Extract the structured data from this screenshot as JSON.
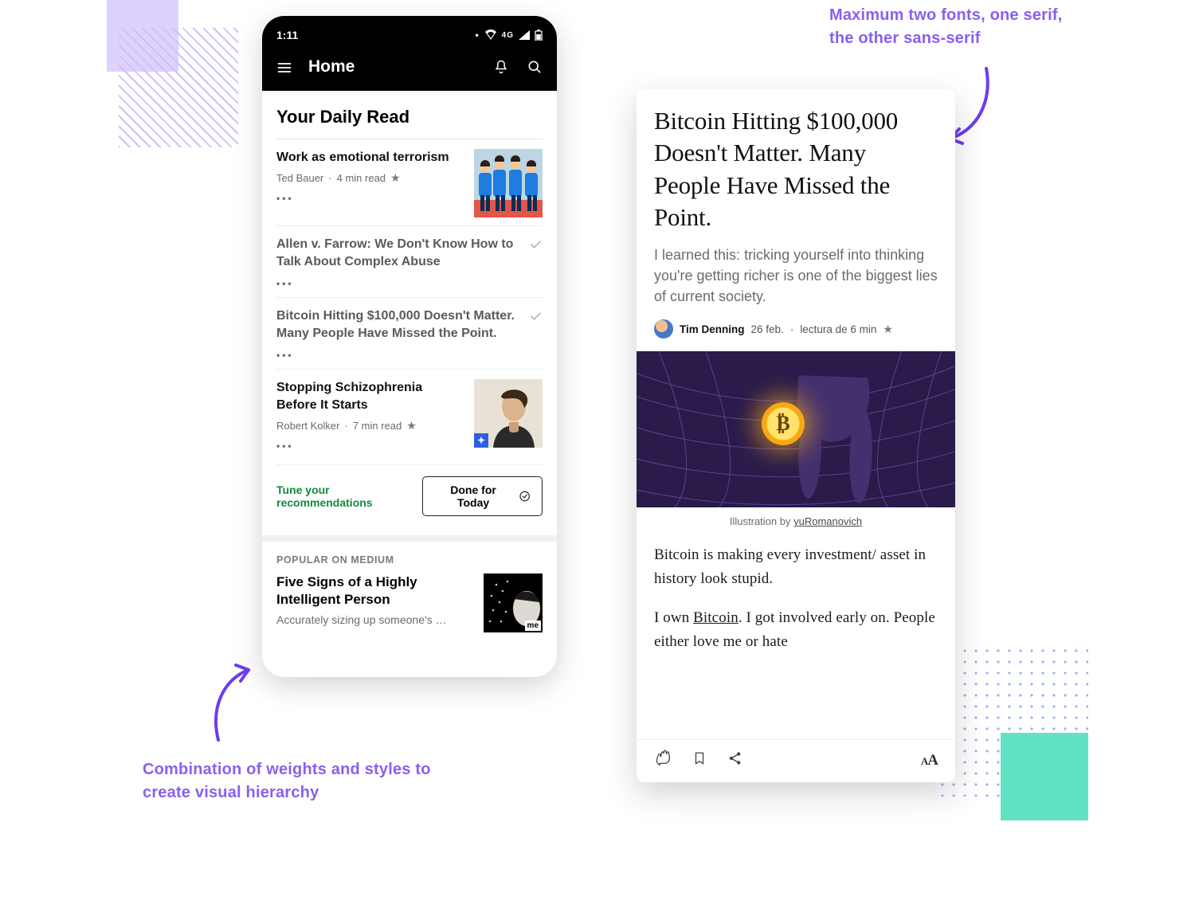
{
  "annotations": {
    "top_right": "Maximum two fonts, one serif, the other sans-serif",
    "bottom_left": "Combination of weights and styles to create visual hierarchy"
  },
  "phone1": {
    "status_time": "1:11",
    "status_net": "4G",
    "nav_title": "Home",
    "section_title": "Your Daily Read",
    "articles": [
      {
        "title": "Work as emotional terrorism",
        "author": "Ted Bauer",
        "meta": "4 min read",
        "has_thumb": true,
        "muted": false
      },
      {
        "title": "Allen v. Farrow: We Don't Know How to Talk About Complex Abuse",
        "has_thumb": false,
        "muted": true
      },
      {
        "title": "Bitcoin Hitting $100,000 Doesn't Matter. Many People Have Missed the Point.",
        "has_thumb": false,
        "muted": true
      },
      {
        "title": "Stopping Schizophrenia Before It Starts",
        "author": "Robert Kolker",
        "meta": "7 min read",
        "has_thumb": true,
        "has_badge": true,
        "muted": false
      }
    ],
    "tune_label": "Tune your recommendations",
    "done_label": "Done for Today",
    "popular_label": "POPULAR ON MEDIUM",
    "popular_title": "Five Signs of a Highly Intelligent Person",
    "popular_sub": "Accurately sizing up someone's …",
    "popular_thumb_badge": "me"
  },
  "phone2": {
    "title": "Bitcoin Hitting $100,000 Doesn't Matter. Many People Have Missed the Point.",
    "subtitle": "I learned this: tricking yourself into thinking you're getting richer is one of the biggest lies of current society.",
    "author": "Tim Denning",
    "date": "26 feb.",
    "readtime": "lectura de 6 min",
    "caption_prefix": "Illustration by ",
    "caption_link": "yuRomanovich",
    "para1": "Bitcoin is making every investment/ asset in history look stupid.",
    "para2_pre": "I own ",
    "para2_link": "Bitcoin",
    "para2_post": ". I got involved early on. People either love me or hate",
    "text_size_label": "AA"
  }
}
